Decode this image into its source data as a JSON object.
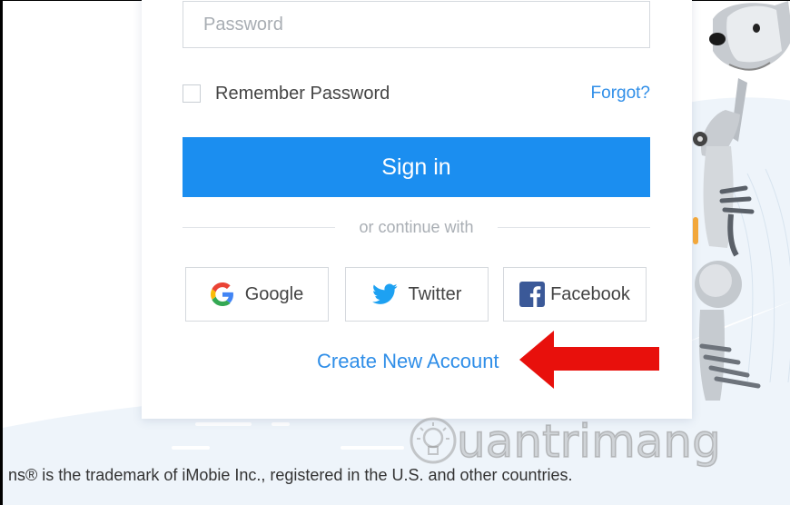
{
  "form": {
    "password_placeholder": "Password",
    "remember_label": "Remember Password",
    "forgot_label": "Forgot?",
    "signin_label": "Sign in",
    "divider_text": "or continue with",
    "create_account_label": "Create New Account"
  },
  "social": [
    {
      "label": "Google",
      "icon": "google-icon"
    },
    {
      "label": "Twitter",
      "icon": "twitter-icon"
    },
    {
      "label": "Facebook",
      "icon": "facebook-icon"
    }
  ],
  "footer": {
    "trademark_text": "ns® is the trademark of iMobie Inc., registered in the U.S. and other countries."
  },
  "watermark": {
    "text": "uantrimang"
  },
  "colors": {
    "primary": "#1b8ef0",
    "link": "#2f8ee8",
    "arrow": "#e8100c",
    "background_wave": "#eef4fa"
  }
}
